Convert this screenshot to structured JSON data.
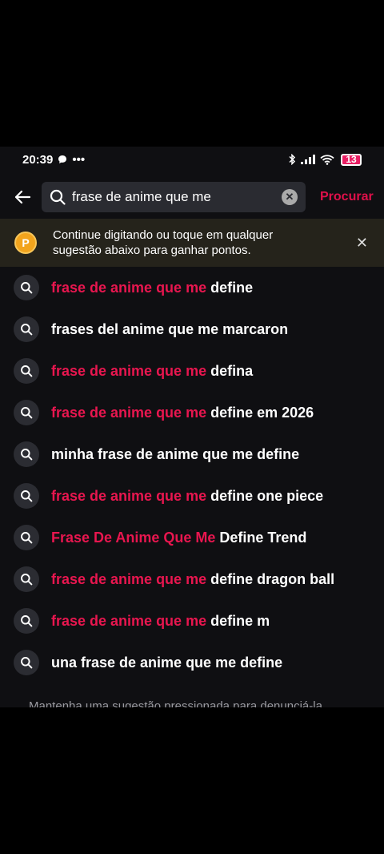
{
  "status": {
    "time": "20:39",
    "extra": "•••",
    "battery": "13"
  },
  "search": {
    "query": "frase de anime que me",
    "button": "Procurar"
  },
  "tip": {
    "coin": "P",
    "text": "Continue digitando ou toque em qualquer sugestão abaixo para ganhar pontos."
  },
  "suggestions": [
    {
      "highlight": "frase de anime que me",
      "rest": " define"
    },
    {
      "highlight": "",
      "rest": "frases del anime que me marcaron"
    },
    {
      "highlight": "frase de anime que me",
      "rest": " defina"
    },
    {
      "highlight": "frase de anime que me",
      "rest": " define em 2026"
    },
    {
      "highlight": "",
      "rest": "minha frase de anime que me define"
    },
    {
      "highlight": "frase de anime que me",
      "rest": " define one piece"
    },
    {
      "highlight": "Frase De Anime Que Me",
      "rest": " Define Trend"
    },
    {
      "highlight": "frase de anime que me",
      "rest": " define dragon ball"
    },
    {
      "highlight": "frase de anime que me",
      "rest": " define m"
    },
    {
      "highlight": "",
      "rest": "una frase de anime que me define"
    }
  ],
  "footer": "Mantenha uma sugestão pressionada para denunciá-la"
}
